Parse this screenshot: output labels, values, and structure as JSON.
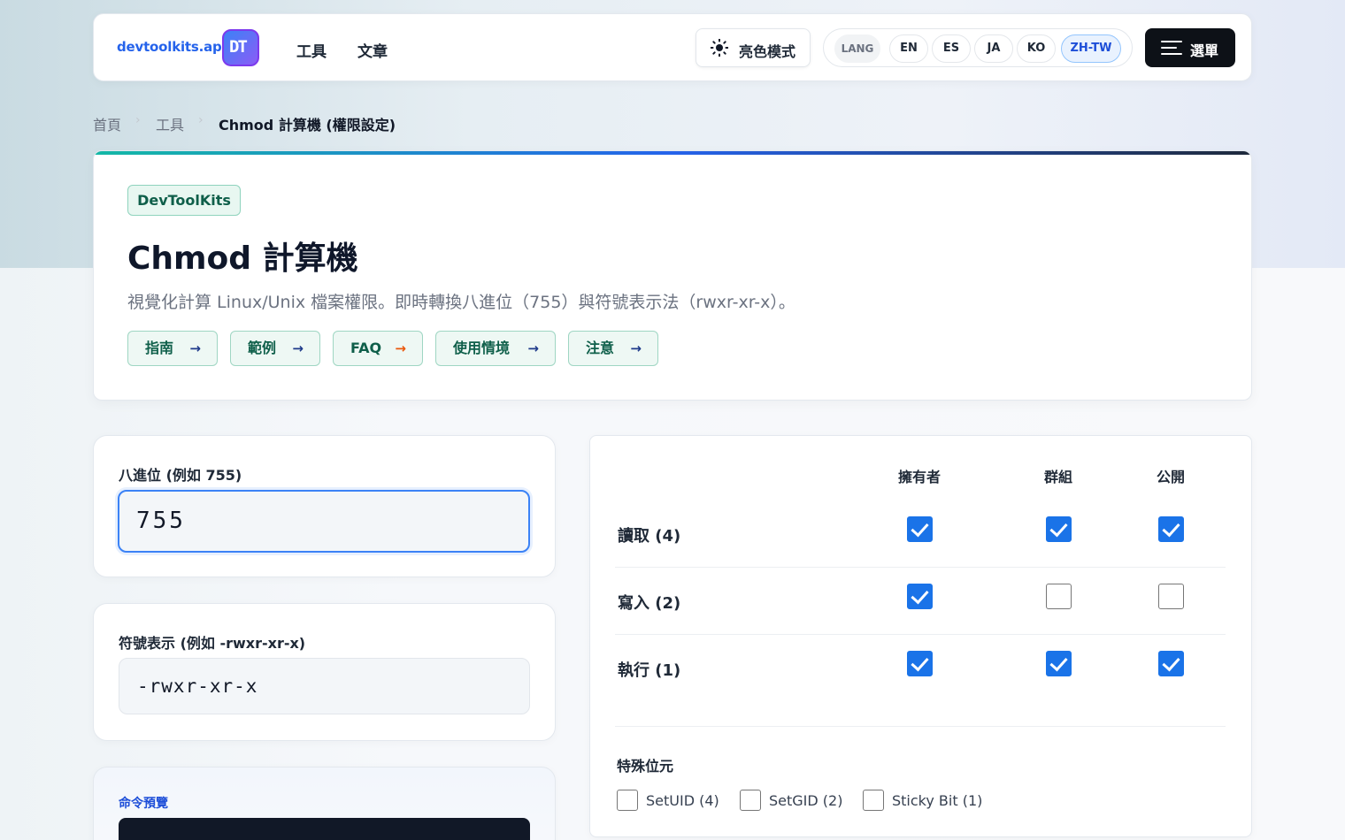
{
  "header": {
    "logo_text": "devtoolkits.app",
    "logo_badge": "DT",
    "nav": [
      "工具",
      "文章"
    ],
    "theme_label": "亮色模式",
    "lang_label": "LANG",
    "languages": [
      "EN",
      "ES",
      "JA",
      "KO",
      "ZH-TW"
    ],
    "active_language": "ZH-TW",
    "menu_label": "選單"
  },
  "breadcrumb": {
    "items": [
      "首頁",
      "工具",
      "Chmod 計算機 (權限設定)"
    ],
    "separator": "›"
  },
  "hero": {
    "tag": "DevToolKits",
    "title": "Chmod 計算機",
    "description": "視覺化計算 Linux/Unix 檔案權限。即時轉換八進位（755）與符號表示法（rwxr-xr-x）。",
    "chips": [
      "指南",
      "範例",
      "FAQ",
      "使用情境",
      "注意"
    ],
    "arrow": "→"
  },
  "octal": {
    "label": "八進位 (例如 755)",
    "value": "755"
  },
  "symbolic": {
    "label": "符號表示 (例如 -rwxr-xr-x)",
    "value": "-rwxr-xr-x"
  },
  "command": {
    "label": "命令預覽"
  },
  "permissions": {
    "columns": [
      "擁有者",
      "群組",
      "公開"
    ],
    "rows": [
      {
        "label": "讀取 (4)",
        "checked": [
          true,
          true,
          true
        ]
      },
      {
        "label": "寫入 (2)",
        "checked": [
          true,
          false,
          false
        ]
      },
      {
        "label": "執行 (1)",
        "checked": [
          true,
          true,
          true
        ]
      }
    ],
    "special_title": "特殊位元",
    "special": [
      {
        "label": "SetUID (4)",
        "checked": false
      },
      {
        "label": "SetGID (2)",
        "checked": false
      },
      {
        "label": "Sticky Bit (1)",
        "checked": false
      }
    ]
  },
  "colors": {
    "accent": "#1a73e8",
    "chip_bg": "#eef8f4",
    "chip_text": "#0f5f4a"
  }
}
